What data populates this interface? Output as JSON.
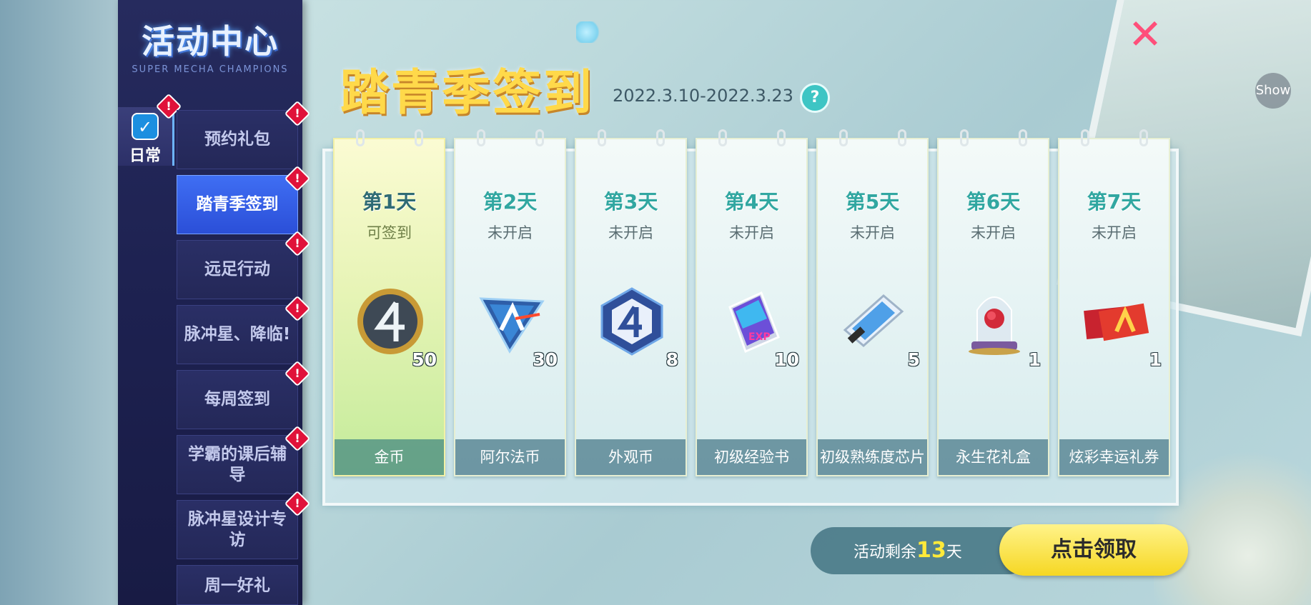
{
  "sidebar": {
    "title": "活动中心",
    "subtitle": "SUPER MECHA CHAMPIONS",
    "category": {
      "label": "日常",
      "icon": "calendar-check-icon"
    },
    "items": [
      {
        "label": "预约礼包",
        "alert": "!"
      },
      {
        "label": "踏青季签到",
        "alert": "!"
      },
      {
        "label": "远足行动",
        "alert": "!"
      },
      {
        "label": "脉冲星、降临!",
        "alert": "!"
      },
      {
        "label": "每周签到",
        "alert": "!"
      },
      {
        "label": "学霸的课后辅导",
        "alert": "!"
      },
      {
        "label": "脉冲星设计专访",
        "alert": "!"
      },
      {
        "label": "周一好礼",
        "alert": ""
      }
    ],
    "active_index": 1
  },
  "header": {
    "title": "踏青季签到",
    "date_range": "2022.3.10-2022.3.23",
    "help": "?",
    "close": "✕",
    "show": "Show"
  },
  "days": [
    {
      "day": "第1天",
      "status": "可签到",
      "quantity": "50",
      "reward": "金币",
      "icon": "gold-coin-icon"
    },
    {
      "day": "第2天",
      "status": "未开启",
      "quantity": "30",
      "reward": "阿尔法币",
      "icon": "alpha-coin-icon"
    },
    {
      "day": "第3天",
      "status": "未开启",
      "quantity": "8",
      "reward": "外观币",
      "icon": "appearance-coin-icon"
    },
    {
      "day": "第4天",
      "status": "未开启",
      "quantity": "10",
      "reward": "初级经验书",
      "icon": "exp-book-icon"
    },
    {
      "day": "第5天",
      "status": "未开启",
      "quantity": "5",
      "reward": "初级熟练度芯片",
      "icon": "chip-icon"
    },
    {
      "day": "第6天",
      "status": "未开启",
      "quantity": "1",
      "reward": "永生花礼盒",
      "icon": "rose-box-icon"
    },
    {
      "day": "第7天",
      "status": "未开启",
      "quantity": "1",
      "reward": "炫彩幸运礼券",
      "icon": "lucky-ticket-icon"
    }
  ],
  "footer": {
    "remaining_prefix": "活动剩余",
    "remaining_days": "13",
    "remaining_suffix": "天",
    "claim_label": "点击领取"
  },
  "colors": {
    "sidebar_bg": "#1d2150",
    "active_nav": "#3f6ef3",
    "title_gold": "#ffd94a",
    "alert_red": "#e0123a",
    "claim_yellow": "#f6d723"
  }
}
